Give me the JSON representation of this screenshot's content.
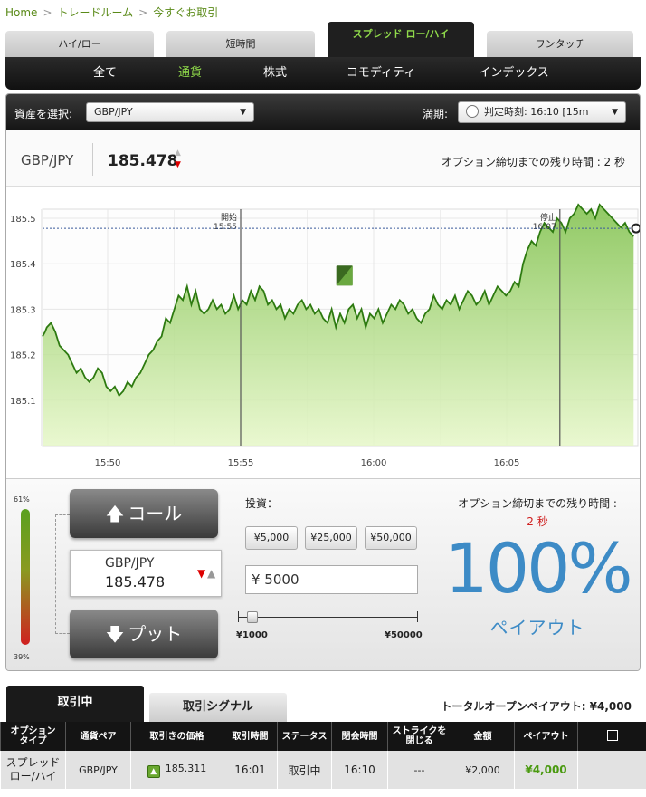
{
  "breadcrumb": [
    "Home",
    "トレードルーム",
    "今すぐお取引"
  ],
  "top_tabs": [
    {
      "label": "ハイ/ロー"
    },
    {
      "label": "短時間"
    },
    {
      "label": "スプレッド ロー/ハイ"
    },
    {
      "label": "ワンタッチ"
    }
  ],
  "categories": [
    {
      "label": "全て"
    },
    {
      "label": "通貨"
    },
    {
      "label": "株式"
    },
    {
      "label": "コモディティ"
    },
    {
      "label": "インデックス"
    }
  ],
  "asset_bar": {
    "select_label": "資産を選択:",
    "selected_asset": "GBP/JPY",
    "expiry_label": "満期:",
    "expiry_value": "判定時刻: 16:10 [15m"
  },
  "info": {
    "pair": "GBP/JPY",
    "price": "185.478",
    "remaining": "オプション締切までの残り時間 : 2 秒"
  },
  "chart_data": {
    "type": "area",
    "x_ticks": [
      "15:50",
      "15:55",
      "16:00",
      "16:05"
    ],
    "y_ticks": [
      "185.5",
      "185.4",
      "185.3",
      "185.2",
      "185.1"
    ],
    "ylim": [
      185.0,
      185.52
    ],
    "current_value": 185.478,
    "markers": [
      {
        "label": "開始",
        "time": "15:55"
      },
      {
        "label": "停止",
        "time": "16:07"
      }
    ],
    "series": [
      {
        "t": [
          15.45,
          15.48,
          15.5,
          15.55,
          15.6,
          15.65,
          15.7,
          15.75,
          15.8,
          15.85,
          15.9,
          15.95,
          16.0,
          16.05,
          16.1,
          16.15,
          16.2,
          16.25,
          16.3,
          16.35,
          16.4,
          16.45,
          16.5,
          16.55,
          16.6,
          16.65,
          16.7,
          16.75,
          16.8,
          16.85,
          16.9,
          16.95,
          17.0,
          17.05,
          17.1,
          17.15,
          17.2,
          17.25,
          17.3,
          17.35,
          17.4,
          17.45,
          17.5,
          17.55,
          17.6,
          17.65,
          17.7,
          17.75,
          17.8,
          17.85,
          17.9,
          17.95,
          18.0,
          18.05,
          18.1,
          18.15,
          18.2,
          18.25,
          18.3,
          18.35,
          18.4,
          18.45,
          18.5,
          18.55,
          18.6,
          18.65,
          18.7,
          18.75,
          18.8,
          18.85,
          18.9,
          18.95,
          19.0,
          19.05,
          19.1,
          19.15,
          19.2,
          19.25,
          19.3,
          19.35,
          19.4,
          19.45,
          19.5,
          19.55,
          19.6,
          19.65,
          19.7,
          19.75,
          19.8,
          19.85,
          19.9,
          19.95,
          20.0,
          20.05,
          20.1,
          20.15,
          20.2,
          20.25,
          20.3,
          20.35,
          20.4,
          20.45,
          20.5,
          20.55,
          20.6,
          20.65,
          20.7,
          20.75,
          20.8,
          20.85,
          20.9,
          20.95,
          21.0,
          21.05,
          21.1,
          21.15,
          21.2,
          21.25,
          21.3,
          21.35,
          21.4,
          21.45,
          21.5,
          21.55,
          21.6,
          21.65,
          21.7,
          21.75,
          21.8,
          21.85,
          21.9,
          21.95,
          22.0,
          22.05,
          22.1,
          22.15,
          22.2,
          22.25,
          22.3,
          22.35,
          22.4
        ],
        "v": [
          185.24,
          185.25,
          185.26,
          185.27,
          185.25,
          185.22,
          185.21,
          185.2,
          185.18,
          185.16,
          185.17,
          185.15,
          185.14,
          185.15,
          185.17,
          185.16,
          185.13,
          185.12,
          185.13,
          185.11,
          185.12,
          185.14,
          185.13,
          185.15,
          185.16,
          185.18,
          185.2,
          185.21,
          185.23,
          185.24,
          185.28,
          185.27,
          185.3,
          185.33,
          185.32,
          185.35,
          185.31,
          185.34,
          185.3,
          185.29,
          185.3,
          185.32,
          185.3,
          185.31,
          185.29,
          185.3,
          185.33,
          185.3,
          185.32,
          185.31,
          185.34,
          185.32,
          185.35,
          185.34,
          185.31,
          185.32,
          185.3,
          185.31,
          185.28,
          185.3,
          185.29,
          185.31,
          185.32,
          185.3,
          185.31,
          185.29,
          185.3,
          185.28,
          185.27,
          185.3,
          185.26,
          185.29,
          185.27,
          185.3,
          185.31,
          185.28,
          185.3,
          185.26,
          185.29,
          185.28,
          185.3,
          185.27,
          185.29,
          185.31,
          185.3,
          185.32,
          185.31,
          185.29,
          185.3,
          185.28,
          185.27,
          185.29,
          185.3,
          185.33,
          185.31,
          185.3,
          185.32,
          185.31,
          185.33,
          185.3,
          185.32,
          185.34,
          185.33,
          185.31,
          185.32,
          185.34,
          185.31,
          185.33,
          185.35,
          185.34,
          185.33,
          185.34,
          185.36,
          185.35,
          185.4,
          185.43,
          185.45,
          185.44,
          185.47,
          185.49,
          185.48,
          185.47,
          185.5,
          185.49,
          185.47,
          185.5,
          185.51,
          185.53,
          185.52,
          185.51,
          185.52,
          185.5,
          185.53,
          185.52,
          185.51,
          185.5,
          185.49,
          185.48,
          185.49,
          185.47,
          185.46
        ]
      }
    ]
  },
  "trade": {
    "meter_top": "61%",
    "meter_bottom": "39%",
    "call_label": "コール",
    "put_label": "プット",
    "pair": "GBP/JPY",
    "price": "185.478",
    "invest_label": "投資：",
    "amounts": [
      "¥5,000",
      "¥25,000",
      "¥50,000"
    ],
    "amount_input": "¥  5000",
    "slider_min": "¥1000",
    "slider_max": "¥50000",
    "slider_level": 0.08,
    "remain_label": "オプション締切までの残り時間 :",
    "remain_secs": "2 秒",
    "payout_pct": "100%",
    "payout_label": "ペイアウト"
  },
  "bottom": {
    "tab_active": "取引中",
    "tab_inactive": "取引シグナル",
    "total_payout": "トータルオープンペイアウト: ¥4,000",
    "headers": [
      "オプション\nタイプ",
      "通貨ペア",
      "取引きの価格",
      "取引時間",
      "ステータス",
      "閉会時間",
      "ストライクを\n閉じる",
      "金額",
      "ペイアウト",
      ""
    ],
    "rows": [
      [
        "スプレッド\nロー/ハイ",
        "GBP/JPY",
        "185.311",
        "16:01",
        "取引中",
        "16:10",
        "---",
        "¥2,000",
        "¥4,000"
      ]
    ]
  },
  "colors": {
    "accent_green": "#8fd94a",
    "payout_blue": "#3d8bc6",
    "down_red": "#d00000"
  }
}
